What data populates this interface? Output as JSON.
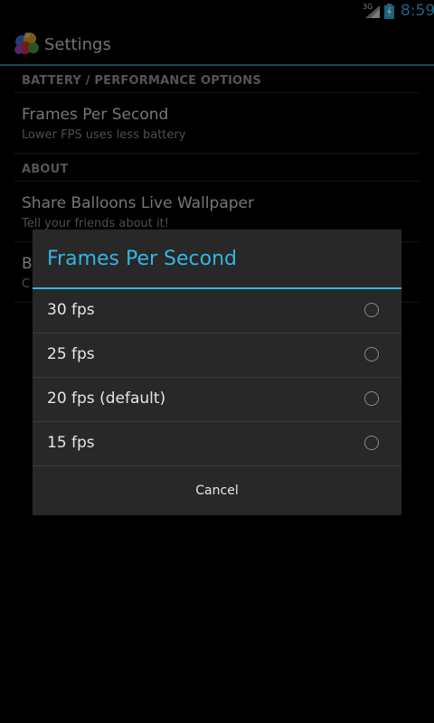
{
  "status_bar": {
    "network": "3G",
    "time": "8:59",
    "signal_icon": "signal-icon",
    "battery_icon": "battery-charging-icon",
    "time_color": "#33b5e5"
  },
  "action_bar": {
    "icon": "balloons-app-icon",
    "title": "Settings",
    "accent": "#33b5e5"
  },
  "preferences": {
    "categories": [
      {
        "header": "BATTERY / PERFORMANCE OPTIONS",
        "items": [
          {
            "title": "Frames Per Second",
            "summary": "Lower FPS uses less battery"
          }
        ]
      },
      {
        "header": "ABOUT",
        "items": [
          {
            "title": "Share Balloons Live Wallpaper",
            "summary": "Tell your friends about it!"
          },
          {
            "title": "B",
            "summary": "C"
          }
        ]
      }
    ]
  },
  "dialog": {
    "title": "Frames Per Second",
    "options": [
      {
        "label": "30 fps",
        "selected": false
      },
      {
        "label": "25 fps",
        "selected": false
      },
      {
        "label": "20 fps (default)",
        "selected": false
      },
      {
        "label": "15 fps",
        "selected": false
      }
    ],
    "cancel_label": "Cancel"
  }
}
